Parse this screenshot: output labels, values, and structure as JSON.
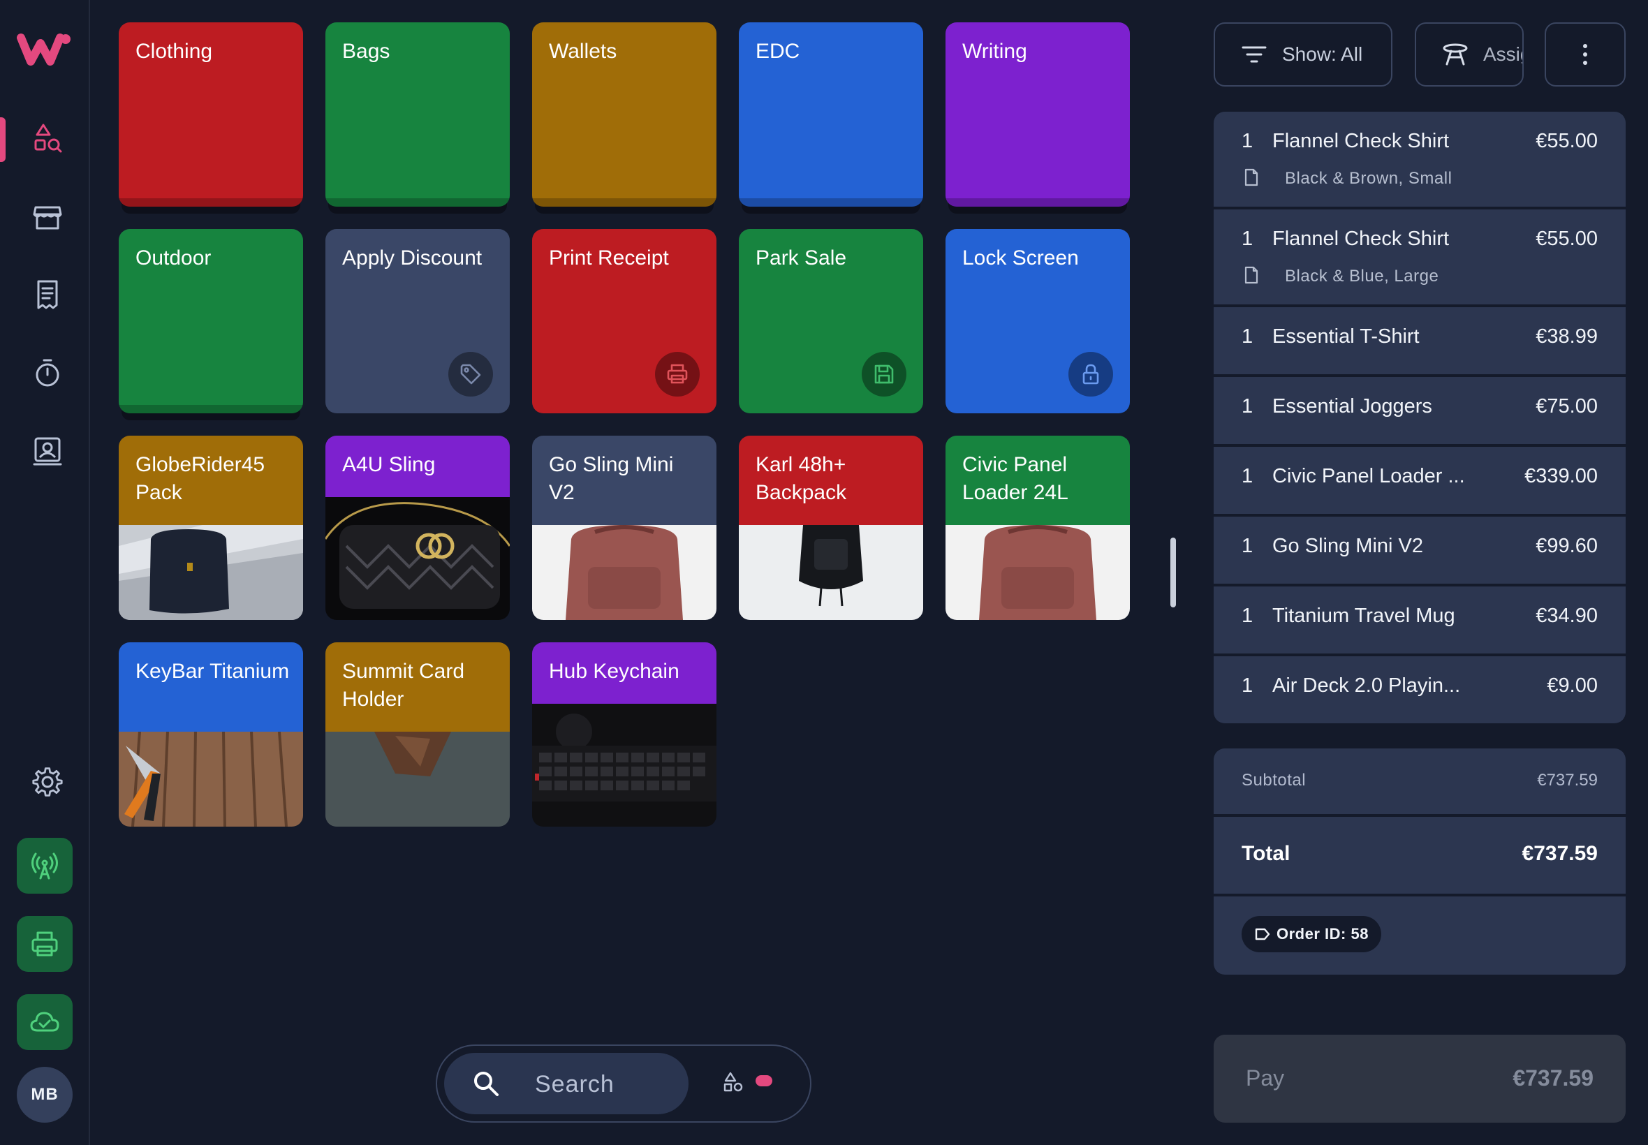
{
  "colors": {
    "accent": "#e4497f",
    "background": "#141a2a",
    "panel_row": "#2c3650",
    "tile_red": "#bd1c22",
    "tile_green": "#17843f",
    "tile_amber": "#a06d08",
    "tile_blue": "#2462d4",
    "tile_purple": "#7d21cf",
    "tile_slate": "#3a4767",
    "status_green": "#17633a"
  },
  "sidebar": {
    "items": [
      {
        "icon": "shapes-search-icon",
        "active": true
      },
      {
        "icon": "store-icon",
        "active": false
      },
      {
        "icon": "receipt-icon",
        "active": false
      },
      {
        "icon": "timer-icon",
        "active": false
      },
      {
        "icon": "customer-badge-icon",
        "active": false
      }
    ],
    "settings_icon": "gear-icon",
    "status_icons": [
      "broadcast-icon",
      "printer-icon",
      "cloud-check-icon"
    ],
    "avatar": "MB"
  },
  "grid": {
    "categories": [
      {
        "label": "Clothing",
        "color": "red"
      },
      {
        "label": "Bags",
        "color": "green"
      },
      {
        "label": "Wallets",
        "color": "amber"
      },
      {
        "label": "EDC",
        "color": "blue"
      },
      {
        "label": "Writing",
        "color": "purple"
      },
      {
        "label": "Outdoor",
        "color": "green"
      }
    ],
    "actions": [
      {
        "label": "Apply Discount",
        "icon": "tag-icon",
        "color": "slate"
      },
      {
        "label": "Print Receipt",
        "icon": "printer-icon",
        "color": "red"
      },
      {
        "label": "Park Sale",
        "icon": "save-icon",
        "color": "green"
      },
      {
        "label": "Lock Screen",
        "icon": "lock-icon",
        "color": "blue"
      }
    ],
    "products": [
      {
        "label": "GlobeRider45 Pack",
        "color": "amber"
      },
      {
        "label": "A4U Sling",
        "color": "purple"
      },
      {
        "label": "Go Sling Mini V2",
        "color": "slate"
      },
      {
        "label": "Karl 48h+ Backpack",
        "color": "red"
      },
      {
        "label": "Civic Panel Loader 24L",
        "color": "green"
      },
      {
        "label": "KeyBar Titanium",
        "color": "blue"
      },
      {
        "label": "Summit Card Holder",
        "color": "amber"
      },
      {
        "label": "Hub Keychain",
        "color": "purple"
      }
    ]
  },
  "search": {
    "placeholder": "Search"
  },
  "toolbar": {
    "show_label": "Show: All",
    "assign_label": "Assign",
    "more_icon": "more-vertical-icon"
  },
  "cart": {
    "items": [
      {
        "qty": "1",
        "name": "Flannel Check Shirt",
        "price": "€55.00",
        "variant": "Black & Brown, Small"
      },
      {
        "qty": "1",
        "name": "Flannel Check Shirt",
        "price": "€55.00",
        "variant": "Black & Blue, Large"
      },
      {
        "qty": "1",
        "name": "Essential T-Shirt",
        "price": "€38.99"
      },
      {
        "qty": "1",
        "name": "Essential Joggers",
        "price": "€75.00"
      },
      {
        "qty": "1",
        "name": "Civic Panel Loader ...",
        "price": "€339.00"
      },
      {
        "qty": "1",
        "name": "Go Sling Mini V2",
        "price": "€99.60"
      },
      {
        "qty": "1",
        "name": "Titanium Travel Mug",
        "price": "€34.90"
      },
      {
        "qty": "1",
        "name": "Air Deck 2.0 Playin...",
        "price": "€9.00"
      }
    ]
  },
  "totals": {
    "subtotal_label": "Subtotal",
    "subtotal_value": "€737.59",
    "total_label": "Total",
    "total_value": "€737.59",
    "order_id_label": "Order ID: 58"
  },
  "pay": {
    "label": "Pay",
    "amount": "€737.59"
  }
}
